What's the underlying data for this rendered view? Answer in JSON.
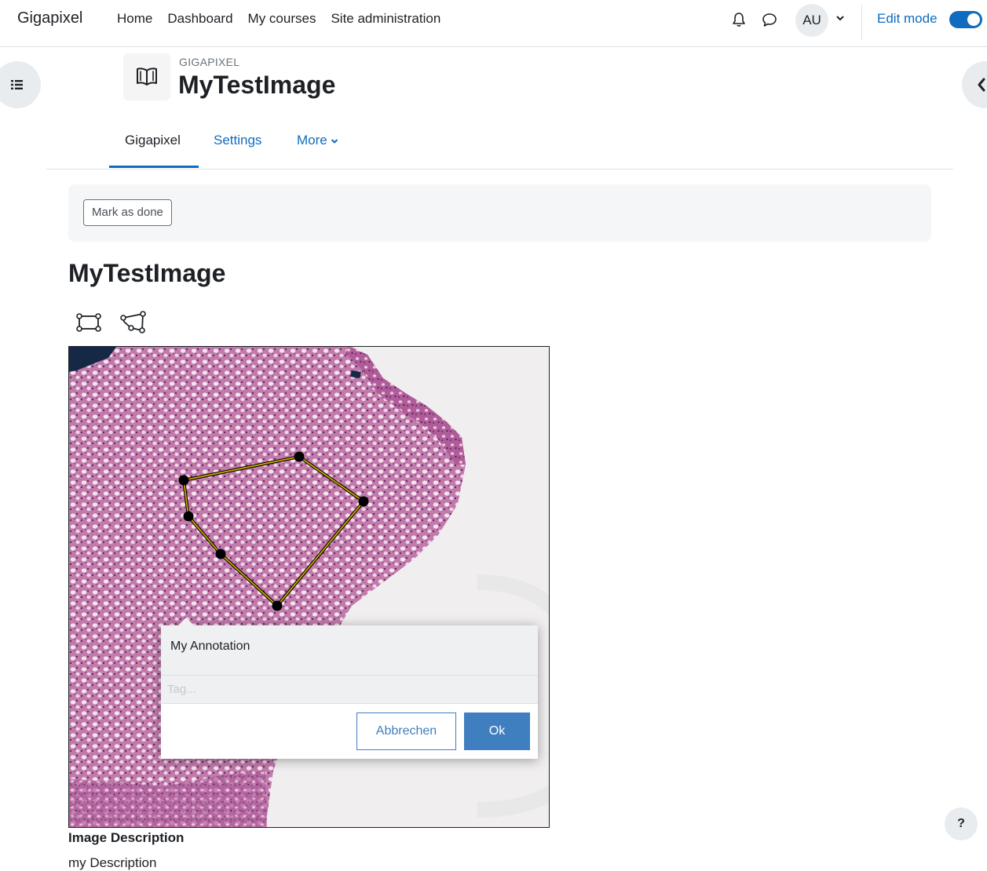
{
  "navbar": {
    "brand": "Gigapixel",
    "links": [
      "Home",
      "Dashboard",
      "My courses",
      "Site administration"
    ],
    "icons": [
      "bell-icon",
      "chat-icon"
    ],
    "user_initials": "AU",
    "edit_mode_label": "Edit mode",
    "edit_mode_on": true
  },
  "header": {
    "context": "GIGAPIXEL",
    "title": "MyTestImage",
    "activity_icon": "book-icon"
  },
  "secondary_nav": {
    "tabs": [
      "Gigapixel",
      "Settings",
      "More"
    ],
    "active_tab": "Gigapixel"
  },
  "completion": {
    "mark_done_label": "Mark as done"
  },
  "content": {
    "title": "MyTestImage",
    "tools": [
      "rectangle-tool-icon",
      "polygon-tool-icon"
    ]
  },
  "annotation": {
    "text": "My Annotation",
    "tag_placeholder": "Tag...",
    "cancel_label": "Abbrechen",
    "ok_label": "Ok"
  },
  "description": {
    "heading": "Image Description",
    "text": "my Description"
  },
  "help": {
    "label": "?"
  },
  "colors": {
    "accent": "#0f6cbf",
    "popup_button": "#3f7fbf",
    "polygon_stroke": "#c9a800",
    "tissue": "#b9609b"
  }
}
